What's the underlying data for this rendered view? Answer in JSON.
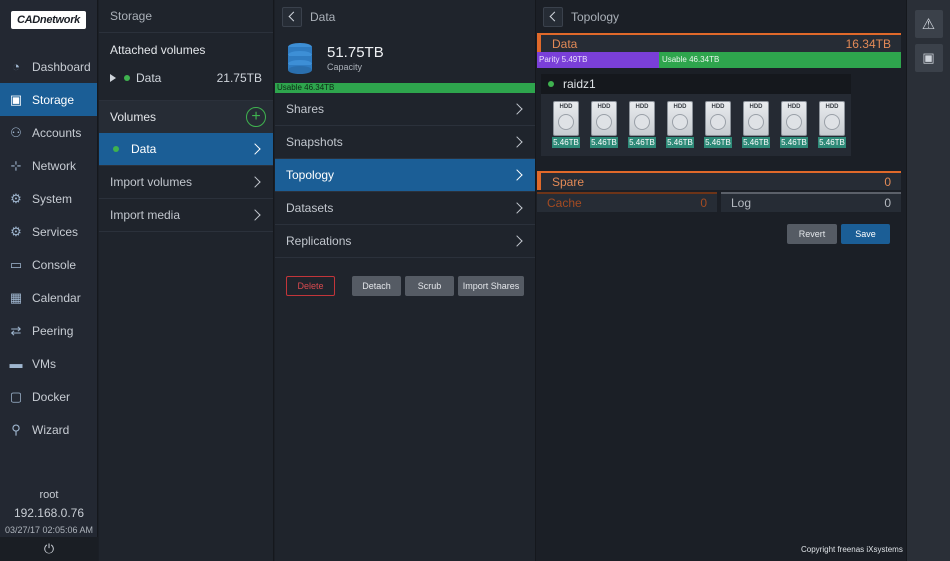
{
  "brand": {
    "logo_text": "CADnetwork"
  },
  "sidebar": {
    "items": [
      {
        "label": "Dashboard",
        "icon": "dashboard-icon",
        "glyph": "◔"
      },
      {
        "label": "Storage",
        "icon": "storage-icon",
        "glyph": "▣",
        "active": true
      },
      {
        "label": "Accounts",
        "icon": "accounts-icon",
        "glyph": "⚇"
      },
      {
        "label": "Network",
        "icon": "network-icon",
        "glyph": "⊹"
      },
      {
        "label": "System",
        "icon": "system-icon",
        "glyph": "⚙"
      },
      {
        "label": "Services",
        "icon": "services-icon",
        "glyph": "⚙"
      },
      {
        "label": "Console",
        "icon": "console-icon",
        "glyph": "▭"
      },
      {
        "label": "Calendar",
        "icon": "calendar-icon",
        "glyph": "▦"
      },
      {
        "label": "Peering",
        "icon": "peering-icon",
        "glyph": "⇄"
      },
      {
        "label": "VMs",
        "icon": "vms-icon",
        "glyph": "▬"
      },
      {
        "label": "Docker",
        "icon": "docker-icon",
        "glyph": "▢"
      },
      {
        "label": "Wizard",
        "icon": "wizard-icon",
        "glyph": "⚲"
      }
    ],
    "user": "root",
    "ip": "192.168.0.76",
    "timestamp": "03/27/17  02:05:06 AM",
    "power_glyph": "⏻"
  },
  "storage": {
    "header": "Storage",
    "attached_title": "Attached volumes",
    "attached": [
      {
        "name": "Data",
        "size": "21.75TB"
      }
    ],
    "volumes_title": "Volumes",
    "add_glyph": "+",
    "list": [
      {
        "label": "Data",
        "active": true,
        "dot": true
      },
      {
        "label": "Import volumes"
      },
      {
        "label": "Import media"
      }
    ]
  },
  "data_panel": {
    "header": "Data",
    "capacity_value": "51.75TB",
    "capacity_label": "Capacity",
    "usable_label": "Usable 46.34TB",
    "menu": [
      {
        "label": "Shares"
      },
      {
        "label": "Snapshots"
      },
      {
        "label": "Topology",
        "active": true
      },
      {
        "label": "Datasets"
      },
      {
        "label": "Replications"
      }
    ],
    "buttons": {
      "delete": "Delete",
      "detach": "Detach",
      "scrub": "Scrub",
      "import_shares": "Import Shares"
    }
  },
  "topology": {
    "header": "Topology",
    "data_group": {
      "title": "Data",
      "value": "16.34TB"
    },
    "parity_label": "Parity 5.49TB",
    "parity_fraction": 0.335,
    "usable_label": "Usable 46.34TB",
    "vdev_name": "raidz1",
    "disk_label": "HDD",
    "disks": [
      "5.46TB",
      "5.46TB",
      "5.46TB",
      "5.46TB",
      "5.46TB",
      "5.46TB",
      "5.46TB",
      "5.46TB"
    ],
    "spare": {
      "title": "Spare",
      "value": "0"
    },
    "cache": {
      "title": "Cache",
      "value": "0"
    },
    "log": {
      "title": "Log",
      "value": "0"
    },
    "buttons": {
      "revert": "Revert",
      "save": "Save"
    }
  },
  "right_strip": {
    "alert_glyph": "⚠",
    "clipboard_glyph": "▣"
  },
  "footer": {
    "copyright": "Copyright freenas iXsystems"
  },
  "colors": {
    "accent": "#1b5e96",
    "green": "#2ea54d",
    "parity": "#7a3fd8",
    "orange": "#e0692a",
    "danger": "#c2353a"
  }
}
